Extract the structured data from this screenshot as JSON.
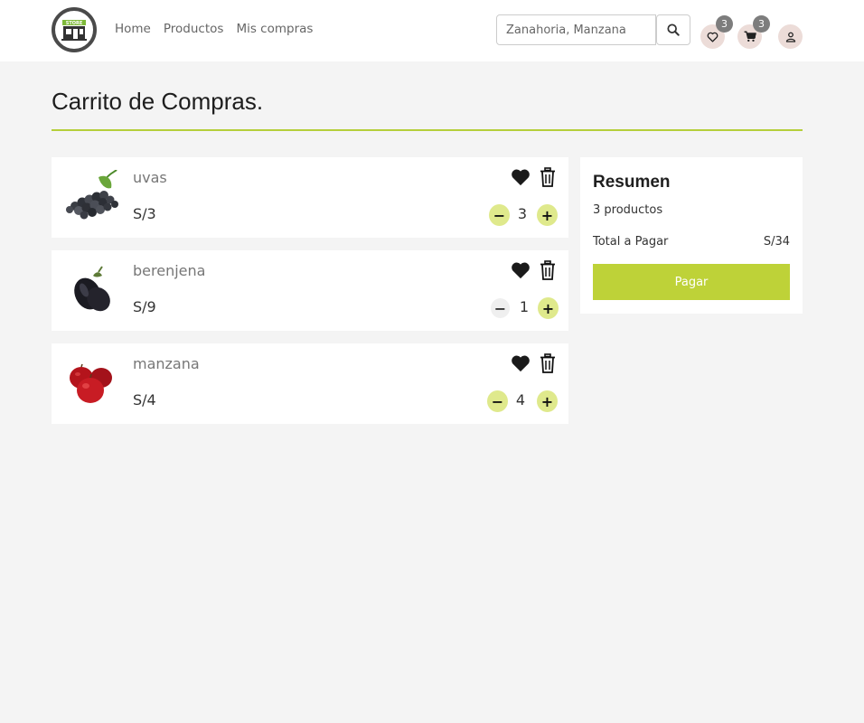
{
  "nav": {
    "logo_text": "STORE",
    "links": [
      "Home",
      "Productos",
      "Mis compras"
    ]
  },
  "search": {
    "placeholder": "Zanahoria, Manzana"
  },
  "header_icons": {
    "favorites_count": "3",
    "cart_count": "3"
  },
  "page": {
    "title": "Carrito de Compras."
  },
  "cart": {
    "items": [
      {
        "name": "uvas",
        "price": "S/3",
        "qty": "3",
        "image": "grapes"
      },
      {
        "name": "berenjena",
        "price": "S/9",
        "qty": "1",
        "image": "eggplant"
      },
      {
        "name": "manzana",
        "price": "S/4",
        "qty": "4",
        "image": "apples"
      }
    ]
  },
  "summary": {
    "title": "Resumen",
    "count": "3 productos",
    "total_label": "Total a Pagar",
    "total_value": "S/34",
    "pay_label": "Pagar"
  },
  "colors": {
    "accent": "#bed238",
    "qty_button": "#dfe98c",
    "badge": "#7d7d7d",
    "icon_bg": "#ecdcd8"
  }
}
